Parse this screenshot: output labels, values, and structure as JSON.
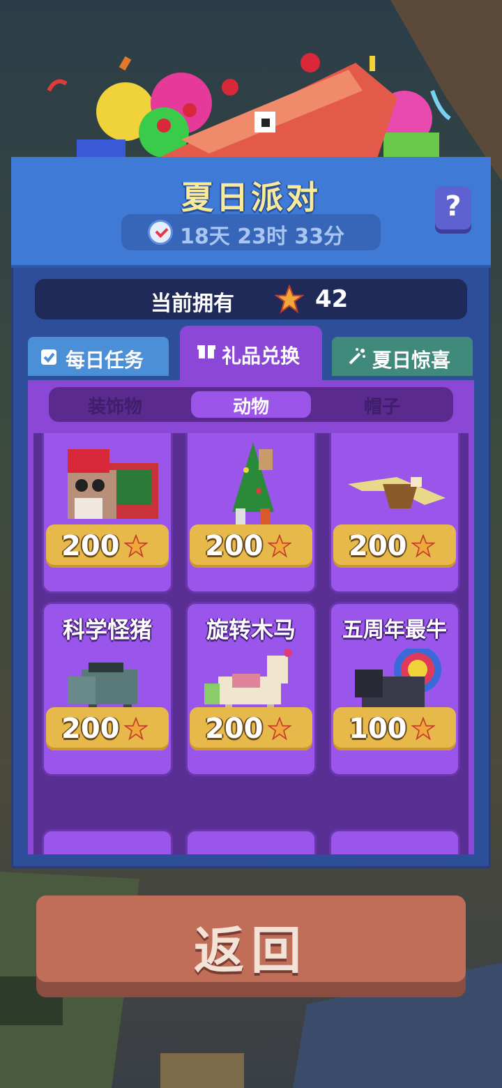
{
  "event": {
    "title": "夏日派对",
    "timer": "18天 23时 33分",
    "help_label": "?"
  },
  "currency": {
    "label": "当前拥有",
    "icon": "star-icon",
    "amount": "42"
  },
  "tabs": [
    {
      "label": "每日任务",
      "icon": "checklist-icon",
      "active": false
    },
    {
      "label": "礼品兑换",
      "icon": "gift-icon",
      "active": true
    },
    {
      "label": "夏日惊喜",
      "icon": "sparkle-icon",
      "active": false
    }
  ],
  "subtabs": [
    {
      "label": "装饰物",
      "active": false
    },
    {
      "label": "动物",
      "active": true
    },
    {
      "label": "帽子",
      "active": false
    }
  ],
  "items": [
    {
      "name": "",
      "price": "200",
      "art": "santa-yak"
    },
    {
      "name": "",
      "price": "200",
      "art": "christmas-tree-zebra"
    },
    {
      "name": "",
      "price": "200",
      "art": "eagle"
    },
    {
      "name": "科学怪猪",
      "price": "200",
      "art": "zombie-boar"
    },
    {
      "name": "旋转木马",
      "price": "200",
      "art": "carousel-horse"
    },
    {
      "name": "五周年最牛",
      "price": "100",
      "art": "feathered-buffalo"
    }
  ],
  "back_button": {
    "label": "返回"
  },
  "colors": {
    "header": "#3f7ad6",
    "panel": "#2d4f9a",
    "content": "#8b47d6",
    "price_button": "#e7b84a",
    "back_button": "#c06e58"
  }
}
